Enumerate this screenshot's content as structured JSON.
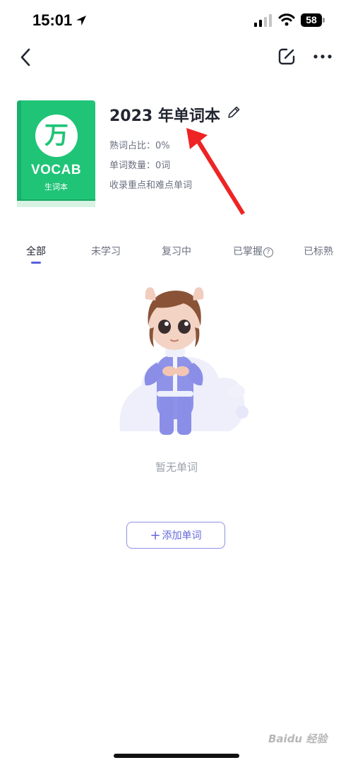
{
  "status_bar": {
    "time": "15:01",
    "battery": "58"
  },
  "nav": {
    "back_icon": "chevron-left-icon",
    "edit_icon": "edit-square-icon",
    "more_icon": "more-horizontal-icon"
  },
  "book": {
    "cover_logo": "万",
    "cover_title": "VOCAB",
    "cover_subtitle": "生词本",
    "title": "2023 年单词本",
    "familiar_ratio": "熟词占比：0%",
    "word_count": "单词数量：0词",
    "description": "收录重点和难点单词"
  },
  "tabs": [
    {
      "label": "全部",
      "active": true
    },
    {
      "label": "未学习",
      "active": false
    },
    {
      "label": "复习中",
      "active": false
    },
    {
      "label": "已掌握",
      "active": false
    },
    {
      "label": "已标熟",
      "active": false
    }
  ],
  "empty_state": {
    "text": "暂无单词"
  },
  "add_button": {
    "plus": "+",
    "label": "添加单词"
  },
  "watermark": "Baidu 经验",
  "colors": {
    "cover_green": "#20c477",
    "accent": "#5b5fe0",
    "arrow_red": "#ee2424"
  }
}
